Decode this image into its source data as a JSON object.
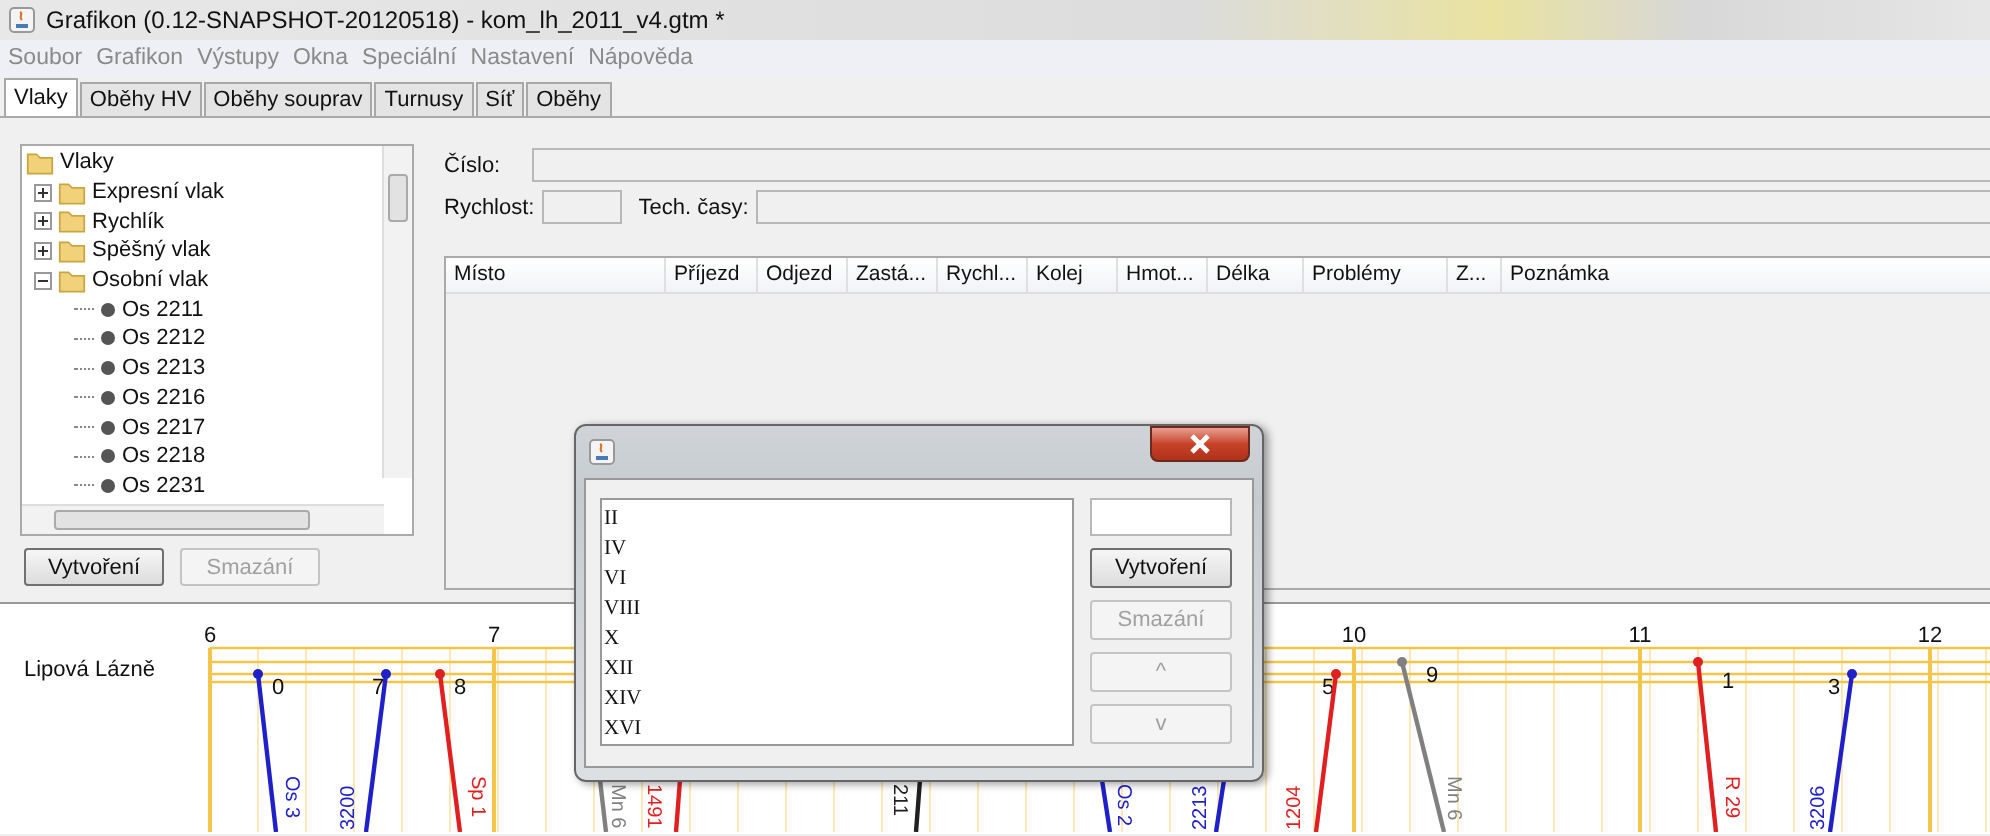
{
  "window": {
    "title": "Grafikon (0.12-SNAPSHOT-20120518) - kom_lh_2011_v4.gtm *"
  },
  "menu": [
    "Soubor",
    "Grafikon",
    "Výstupy",
    "Okna",
    "Speciální",
    "Nastavení",
    "Nápověda"
  ],
  "tabs": [
    {
      "label": "Vlaky",
      "selected": true
    },
    {
      "label": "Oběhy HV",
      "selected": false
    },
    {
      "label": "Oběhy souprav",
      "selected": false
    },
    {
      "label": "Turnusy",
      "selected": false
    },
    {
      "label": "Síť",
      "selected": false
    },
    {
      "label": "Oběhy",
      "selected": false
    }
  ],
  "tree": {
    "label": "Vlaky",
    "kind": "folder",
    "children": [
      {
        "label": "Expresní vlak",
        "kind": "folder",
        "expanded": false
      },
      {
        "label": "Rychlík",
        "kind": "folder",
        "expanded": false
      },
      {
        "label": "Spěšný vlak",
        "kind": "folder",
        "expanded": false
      },
      {
        "label": "Osobní vlak",
        "kind": "folder",
        "expanded": true,
        "children": [
          {
            "label": "Os 2211",
            "kind": "train"
          },
          {
            "label": "Os 2212",
            "kind": "train"
          },
          {
            "label": "Os 2213",
            "kind": "train"
          },
          {
            "label": "Os 2216",
            "kind": "train"
          },
          {
            "label": "Os 2217",
            "kind": "train"
          },
          {
            "label": "Os 2218",
            "kind": "train"
          },
          {
            "label": "Os 2231",
            "kind": "train"
          }
        ]
      }
    ]
  },
  "tree_buttons": [
    {
      "label": "Vytvoření",
      "disabled": false
    },
    {
      "label": "Smazání",
      "disabled": true
    }
  ],
  "form": {
    "number_label": "Číslo:",
    "speed_label": "Rychlost:",
    "tech_label": "Tech. časy:"
  },
  "table": {
    "columns": [
      "Místo",
      "Příjezd",
      "Odjezd",
      "Zastá...",
      "Rychl...",
      "Kolej",
      "Hmot...",
      "Délka",
      "Problémy",
      "Z...",
      "Poznámka"
    ]
  },
  "dialog": {
    "items": [
      "II",
      "IV",
      "VI",
      "VIII",
      "X",
      "XII",
      "XIV",
      "XVI"
    ],
    "buttons": [
      {
        "label": "Vytvoření",
        "disabled": false
      },
      {
        "label": "Smazání",
        "disabled": true
      },
      {
        "label": "^",
        "disabled": true
      },
      {
        "label": "v",
        "disabled": true
      }
    ]
  },
  "graph": {
    "station": "Lipová Lázně",
    "hours": [
      "6",
      "7",
      "10",
      "11",
      "12"
    ],
    "tracks": [
      "0",
      "7",
      "8",
      "5",
      "9",
      "1",
      "3"
    ],
    "trains": [
      {
        "label": "Os 3",
        "color": "#2020c8"
      },
      {
        "label": "3200",
        "color": "#2020c8"
      },
      {
        "label": "Sp 1",
        "color": "#e02020"
      },
      {
        "label": "Mn 6",
        "color": "#808080"
      },
      {
        "label": "1491",
        "color": "#e02020"
      },
      {
        "label": "211",
        "color": "#202020"
      },
      {
        "label": "Os 2",
        "color": "#2020c8"
      },
      {
        "label": "2213",
        "color": "#2020c8"
      },
      {
        "label": "1204",
        "color": "#e02020"
      },
      {
        "label": "Mn 6",
        "color": "#808080"
      },
      {
        "label": "R 29",
        "color": "#e02020"
      },
      {
        "label": "3206",
        "color": "#2020c8"
      }
    ]
  }
}
